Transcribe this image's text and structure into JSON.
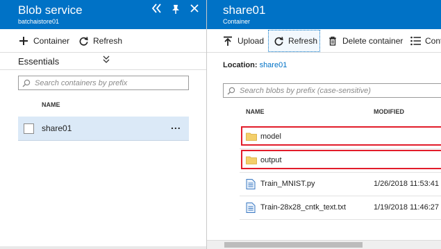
{
  "left_blade": {
    "title": "Blob service",
    "subtitle": "batchaistore01",
    "toolbar": {
      "container_label": "Container",
      "refresh_label": "Refresh"
    },
    "essentials_label": "Essentials",
    "search_placeholder": "Search containers by prefix",
    "column_name": "NAME",
    "rows": [
      {
        "name": "share01",
        "more": "..."
      }
    ]
  },
  "right_blade": {
    "title": "share01",
    "subtitle": "Container",
    "toolbar": {
      "upload_label": "Upload",
      "refresh_label": "Refresh",
      "delete_label": "Delete container",
      "columns_label": "Conta"
    },
    "location_label": "Location:",
    "location_value": "share01",
    "search_placeholder": "Search blobs by prefix (case-sensitive)",
    "column_name": "NAME",
    "column_modified": "MODIFIED",
    "items": [
      {
        "name": "model",
        "modified": "",
        "type": "folder",
        "highlighted": true
      },
      {
        "name": "output",
        "modified": "",
        "type": "folder",
        "highlighted": true
      },
      {
        "name": "Train_MNIST.py",
        "modified": "1/26/2018 11:53:41",
        "type": "file",
        "highlighted": false
      },
      {
        "name": "Train-28x28_cntk_text.txt",
        "modified": "1/19/2018 11:46:27",
        "type": "file",
        "highlighted": false
      }
    ]
  },
  "colors": {
    "header": "#0072c6",
    "highlight_border": "#e21c2a",
    "selected_row": "#dbe9f7",
    "link": "#0072c6"
  },
  "icons": [
    "collapse-icon",
    "pin-icon",
    "close-icon",
    "plus-icon",
    "refresh-icon",
    "chevron-down-icon",
    "search-icon",
    "upload-icon",
    "trash-icon",
    "columns-icon",
    "folder-icon",
    "file-icon"
  ]
}
